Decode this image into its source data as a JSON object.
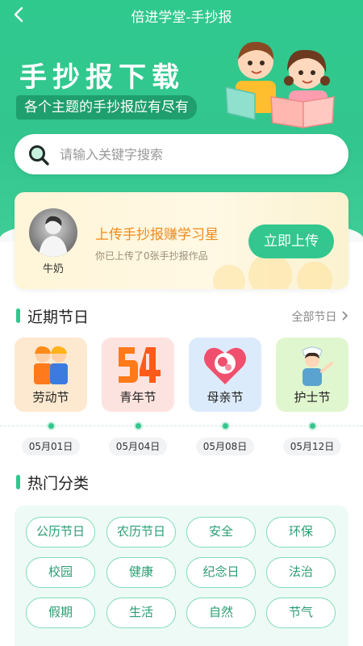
{
  "nav": {
    "title": "倍进学堂-手抄报"
  },
  "hero": {
    "title": "手抄报下载",
    "subtitle": "各个主题的手抄报应有尽有"
  },
  "search": {
    "placeholder": "请输入关键字搜索"
  },
  "upload": {
    "user_name": "牛奶",
    "title": "上传手抄报赚学习星",
    "subtitle": "你已上传了0张手抄报作品",
    "button": "立即上传"
  },
  "recent": {
    "title": "近期节日",
    "more": "全部节日",
    "items": [
      {
        "label": "劳动节",
        "date": "05月01日",
        "bg": "#fde9cf",
        "icon": "workers-icon"
      },
      {
        "label": "青年节",
        "date": "05月04日",
        "bg": "#fde3df",
        "icon": "number-54-icon"
      },
      {
        "label": "母亲节",
        "date": "05月08日",
        "bg": "#dcebfb",
        "icon": "heart-mother-icon"
      },
      {
        "label": "护士节",
        "date": "05月12日",
        "bg": "#e0f6cf",
        "icon": "nurse-icon"
      }
    ]
  },
  "hot": {
    "title": "热门分类",
    "categories": [
      "公历节日",
      "农历节日",
      "安全",
      "环保",
      "校园",
      "健康",
      "纪念日",
      "法治",
      "假期",
      "生活",
      "自然",
      "节气"
    ]
  },
  "colors": {
    "primary": "#33c68e",
    "accent_orange": "#f08a1c"
  }
}
